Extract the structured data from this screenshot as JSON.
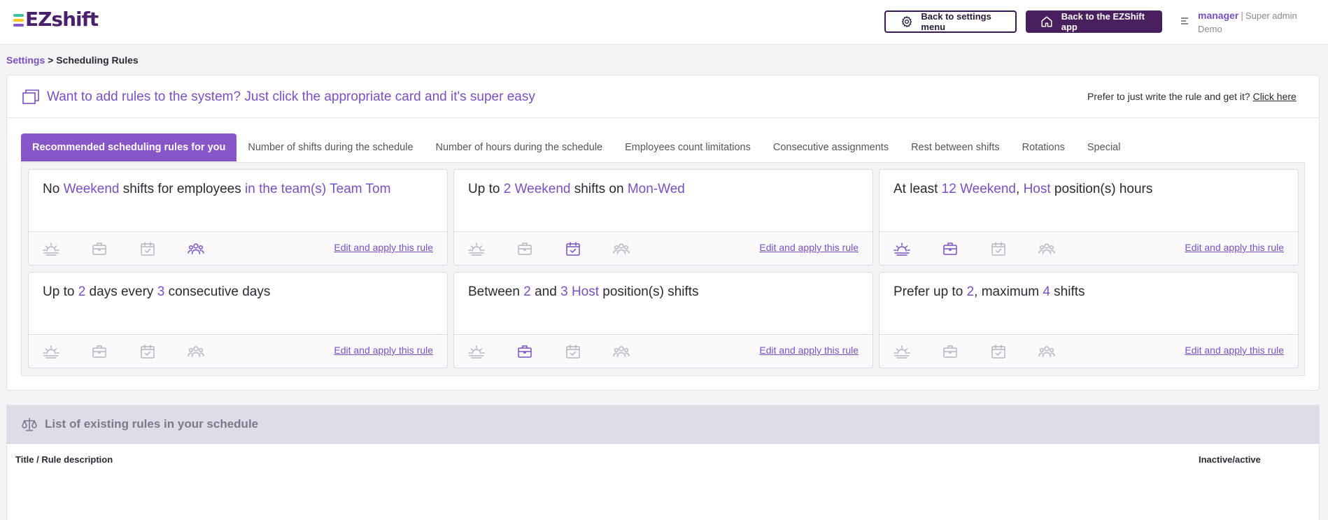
{
  "header": {
    "logo_text": "EZshift",
    "logo_bar_colors": [
      "#3fc1a8",
      "#f5c518",
      "#8856c9"
    ],
    "settings_button_label": "Back to settings menu",
    "app_button_label": "Back to the EZShift app",
    "user_name": "manager",
    "user_role": "Super admin",
    "user_org": "Demo"
  },
  "breadcrumb": {
    "root": "Settings",
    "separator": ">",
    "current": "Scheduling Rules"
  },
  "panel": {
    "headline": "Want to add rules to the system? Just click the appropriate card and it's super easy",
    "prefer_text": "Prefer to just write the rule and get it?",
    "prefer_link": "Click here"
  },
  "tabs": [
    {
      "label": "Recommended scheduling rules for you",
      "active": true
    },
    {
      "label": "Number of shifts during the schedule",
      "active": false
    },
    {
      "label": "Number of hours during the schedule",
      "active": false
    },
    {
      "label": "Employees count limitations",
      "active": false
    },
    {
      "label": "Consecutive assignments",
      "active": false
    },
    {
      "label": "Rest between shifts",
      "active": false
    },
    {
      "label": "Rotations",
      "active": false
    },
    {
      "label": "Special",
      "active": false
    }
  ],
  "cards": [
    {
      "segments": [
        {
          "t": "No ",
          "hl": false
        },
        {
          "t": "Weekend",
          "hl": true
        },
        {
          "t": " shifts for employees ",
          "hl": false
        },
        {
          "t": "in the team(s) Team Tom",
          "hl": true
        }
      ],
      "active_icons": [
        "team"
      ],
      "edit_label": "Edit and apply this rule"
    },
    {
      "segments": [
        {
          "t": "Up to ",
          "hl": false
        },
        {
          "t": "2",
          "hl": true
        },
        {
          "t": " ",
          "hl": false
        },
        {
          "t": "Weekend",
          "hl": true
        },
        {
          "t": " shifts on ",
          "hl": false
        },
        {
          "t": "Mon-Wed",
          "hl": true
        }
      ],
      "active_icons": [
        "calendar"
      ],
      "edit_label": "Edit and apply this rule"
    },
    {
      "segments": [
        {
          "t": "At least ",
          "hl": false
        },
        {
          "t": "12",
          "hl": true
        },
        {
          "t": " ",
          "hl": false
        },
        {
          "t": "Weekend",
          "hl": true
        },
        {
          "t": ", ",
          "hl": false
        },
        {
          "t": "Host",
          "hl": true
        },
        {
          "t": " position(s) hours",
          "hl": false
        }
      ],
      "active_icons": [
        "shift",
        "position"
      ],
      "edit_label": "Edit and apply this rule"
    },
    {
      "segments": [
        {
          "t": "Up to ",
          "hl": false
        },
        {
          "t": "2",
          "hl": true
        },
        {
          "t": " days every ",
          "hl": false
        },
        {
          "t": "3",
          "hl": true
        },
        {
          "t": " consecutive days",
          "hl": false
        }
      ],
      "active_icons": [],
      "edit_label": "Edit and apply this rule"
    },
    {
      "segments": [
        {
          "t": "Between ",
          "hl": false
        },
        {
          "t": "2",
          "hl": true
        },
        {
          "t": " and ",
          "hl": false
        },
        {
          "t": "3",
          "hl": true
        },
        {
          "t": " ",
          "hl": false
        },
        {
          "t": "Host",
          "hl": true
        },
        {
          "t": " position(s) shifts",
          "hl": false
        }
      ],
      "active_icons": [
        "position"
      ],
      "edit_label": "Edit and apply this rule"
    },
    {
      "segments": [
        {
          "t": "Prefer up to ",
          "hl": false
        },
        {
          "t": "2",
          "hl": true
        },
        {
          "t": ", maximum ",
          "hl": false
        },
        {
          "t": "4",
          "hl": true
        },
        {
          "t": " shifts",
          "hl": false
        }
      ],
      "active_icons": [],
      "edit_label": "Edit and apply this rule"
    }
  ],
  "card_icon_names": [
    "shift",
    "position",
    "calendar",
    "team"
  ],
  "existing": {
    "title": "List of existing rules in your schedule",
    "col_title": "Title / Rule description",
    "col_active": "Inactive/active"
  },
  "colors": {
    "accent": "#7b4fc4",
    "brand_dark": "#4a1f5e",
    "icon_inactive": "#b5b5bf"
  }
}
